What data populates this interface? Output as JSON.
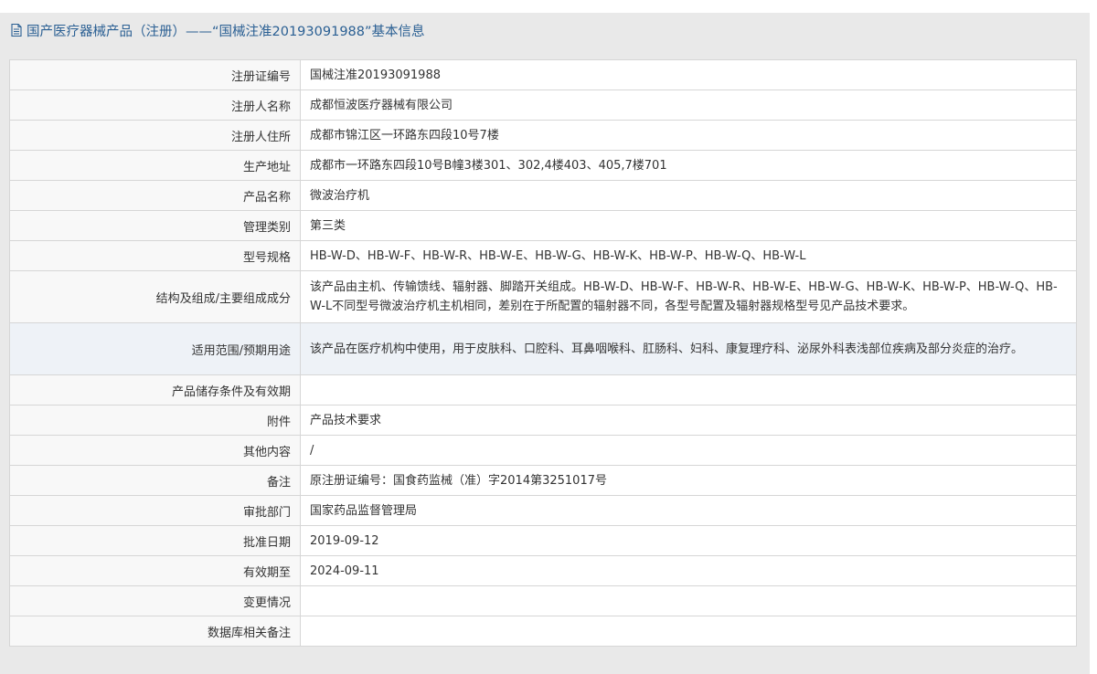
{
  "header": {
    "title": "国产医疗器械产品（注册）——“国械注准20193091988”基本信息",
    "icon": "document-icon",
    "title_color": "#2a5f93"
  },
  "rows": [
    {
      "label": "注册证编号",
      "value": "国械注准20193091988"
    },
    {
      "label": "注册人名称",
      "value": "成都恒波医疗器械有限公司"
    },
    {
      "label": "注册人住所",
      "value": "成都市锦江区一环路东四段10号7楼"
    },
    {
      "label": "生产地址",
      "value": "成都市一环路东四段10号B幢3楼301、302,4楼403、405,7楼701"
    },
    {
      "label": "产品名称",
      "value": "微波治疗机"
    },
    {
      "label": "管理类别",
      "value": "第三类"
    },
    {
      "label": "型号规格",
      "value": "HB-W-D、HB-W-F、HB-W-R、HB-W-E、HB-W-G、HB-W-K、HB-W-P、HB-W-Q、HB-W-L"
    },
    {
      "label": "结构及组成/主要组成成分",
      "value": "该产品由主机、传输馈线、辐射器、脚踏开关组成。HB-W-D、HB-W-F、HB-W-R、HB-W-E、HB-W-G、HB-W-K、HB-W-P、HB-W-Q、HB-W-L不同型号微波治疗机主机相同，差别在于所配置的辐射器不同，各型号配置及辐射器规格型号见产品技术要求。"
    },
    {
      "label": "适用范围/预期用途",
      "value": "该产品在医疗机构中使用，用于皮肤科、口腔科、耳鼻咽喉科、肛肠科、妇科、康复理疗科、泌尿外科表浅部位疾病及部分炎症的治疗。"
    },
    {
      "label": "产品储存条件及有效期",
      "value": ""
    },
    {
      "label": "附件",
      "value": "产品技术要求"
    },
    {
      "label": "其他内容",
      "value": "/"
    },
    {
      "label": "备注",
      "value": "原注册证编号：国食药监械（准）字2014第3251017号"
    },
    {
      "label": "审批部门",
      "value": "国家药品监督管理局"
    },
    {
      "label": "批准日期",
      "value": "2019-09-12"
    },
    {
      "label": "有效期至",
      "value": "2024-09-11"
    },
    {
      "label": "变更情况",
      "value": ""
    },
    {
      "label": "数据库相关备注",
      "value": ""
    }
  ]
}
